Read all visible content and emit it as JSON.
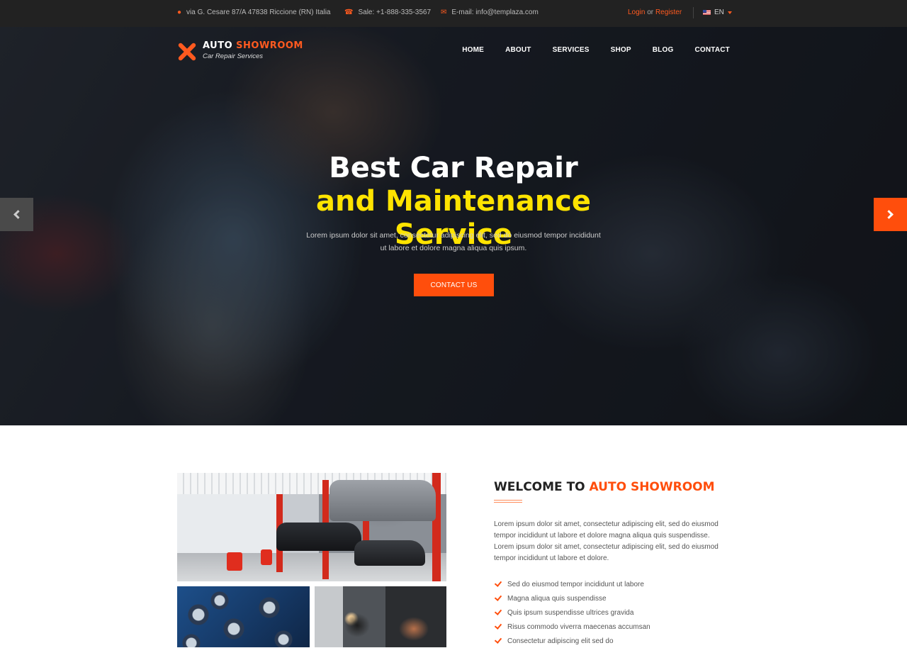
{
  "topbar": {
    "address": "via G. Cesare 87/A 47838 Riccione (RN) Italia",
    "phone": "Sale: +1-888-335-3567",
    "email": "E-mail: info@templaza.com",
    "login": "Login",
    "or": "or",
    "register": "Register",
    "language": "EN",
    "icons": [
      "map-marker-icon",
      "phone-icon",
      "envelope-icon",
      "flag-us-icon",
      "caret-down-icon"
    ]
  },
  "brand": {
    "name_part1": "AUTO",
    "name_part2": "SHOWROOM",
    "tagline": "Car Repair Services"
  },
  "nav": [
    "HOME",
    "ABOUT",
    "SERVICES",
    "SHOP",
    "BLOG",
    "CONTACT"
  ],
  "hero": {
    "title_line1": "Best Car Repair",
    "title_line2": "and Maintenance Service",
    "subtitle": "Lorem ipsum dolor sit amet, consectetur adipiscing elit, sed do eiusmod tempor incididunt ut labore et dolore magna aliqua quis ipsum.",
    "cta": "CONTACT US"
  },
  "colors": {
    "accent": "#ff4e0c",
    "highlight": "#ffe400",
    "topbar": "#222222"
  },
  "about": {
    "heading_part1": "WELCOME TO",
    "heading_part2": "AUTO SHOWROOM",
    "intro": "Lorem ipsum dolor sit amet, consectetur adipiscing elit, sed do eiusmod tempor incididunt ut labore et dolore magna aliqua quis suspendisse. Lorem ipsum dolor sit amet, consectetur adipiscing elit, sed do eiusmod tempor incididunt ut labore et dolore.",
    "features": [
      "Sed do eiusmod tempor incididunt ut labore",
      "Magna aliqua quis suspendisse",
      "Quis ipsum suspendisse ultrices gravida",
      "Risus commodo viverra maecenas accumsan",
      "Consectetur adipiscing elit sed do"
    ]
  }
}
